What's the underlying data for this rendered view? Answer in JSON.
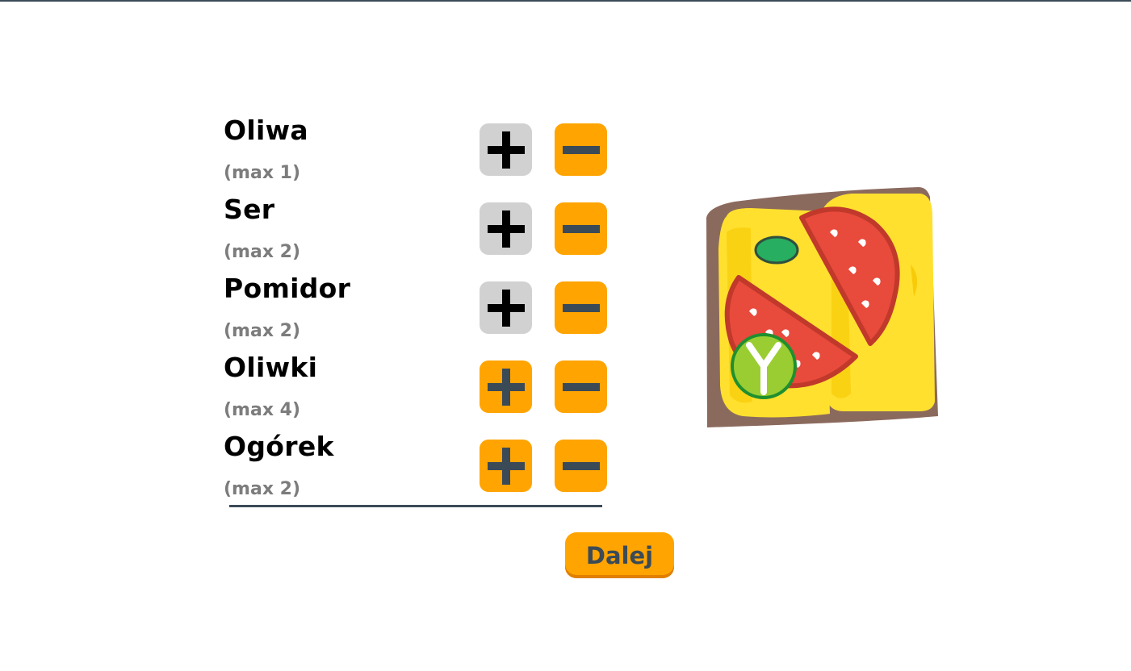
{
  "ingredients": [
    {
      "name": "Oliwa",
      "max_label": "(max 1)",
      "plus_enabled": false,
      "minus_enabled": true
    },
    {
      "name": "Ser",
      "max_label": "(max 2)",
      "plus_enabled": false,
      "minus_enabled": true
    },
    {
      "name": "Pomidor",
      "max_label": "(max 2)",
      "plus_enabled": false,
      "minus_enabled": true
    },
    {
      "name": "Oliwki",
      "max_label": "(max 4)",
      "plus_enabled": true,
      "minus_enabled": true
    },
    {
      "name": "Ogórek",
      "max_label": "(max 2)",
      "plus_enabled": true,
      "minus_enabled": true
    }
  ],
  "next_button": {
    "label": "Dalej"
  },
  "icons": {
    "plus": "plus-icon",
    "minus": "minus-icon"
  },
  "colors": {
    "accent": "#ffa400",
    "disabled": "#d1d1d1",
    "dark": "#3b4a57",
    "label_grey": "#7c7c7c",
    "bread_crust": "#8b6a5e",
    "cheese": "#ffe02e",
    "tomato": "#e84a3c",
    "olive": "#27ae60",
    "cucumber": "#9acd32"
  }
}
